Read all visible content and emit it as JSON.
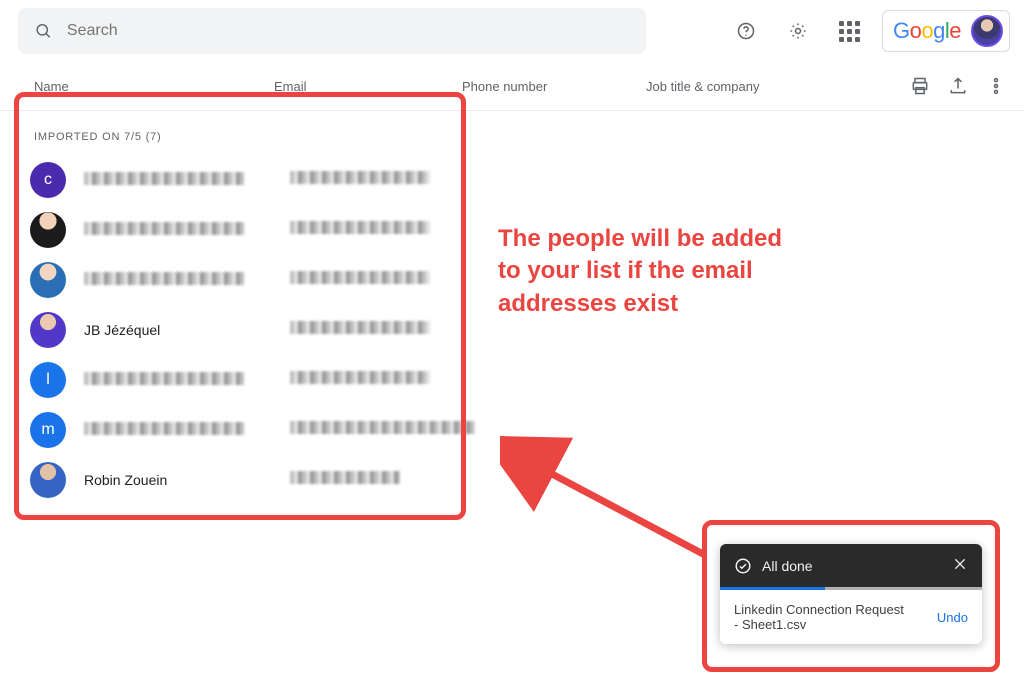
{
  "search": {
    "placeholder": "Search"
  },
  "brand": "Google",
  "columns": {
    "name": "Name",
    "email": "Email",
    "phone": "Phone number",
    "job": "Job title & company"
  },
  "section": {
    "title": "IMPORTED ON 7/5 (7)"
  },
  "contacts": [
    {
      "avatar_type": "letter",
      "letter": "c",
      "avatar_class": "letter-c",
      "name_visible": false,
      "name": ""
    },
    {
      "avatar_type": "photo",
      "avatar_class": "photo1",
      "name_visible": false,
      "name": ""
    },
    {
      "avatar_type": "photo",
      "avatar_class": "photo2",
      "name_visible": false,
      "name": ""
    },
    {
      "avatar_type": "photo",
      "avatar_class": "photo3",
      "name_visible": true,
      "name": "JB Jézéquel"
    },
    {
      "avatar_type": "letter",
      "letter": "l",
      "avatar_class": "letter-l",
      "name_visible": false,
      "name": ""
    },
    {
      "avatar_type": "letter",
      "letter": "m",
      "avatar_class": "letter-m",
      "name_visible": false,
      "name": ""
    },
    {
      "avatar_type": "photo",
      "avatar_class": "photo4",
      "name_visible": true,
      "name": "Robin Zouein"
    }
  ],
  "annotation": {
    "line1": "The people will be added",
    "line2": "to your list if the email",
    "line3": "addresses exist"
  },
  "toast": {
    "status": "All done",
    "file": "Linkedin Connection Request - Sheet1.csv",
    "undo": "Undo"
  },
  "colors": {
    "accent_red": "#ea4540",
    "link_blue": "#1a73e8"
  }
}
